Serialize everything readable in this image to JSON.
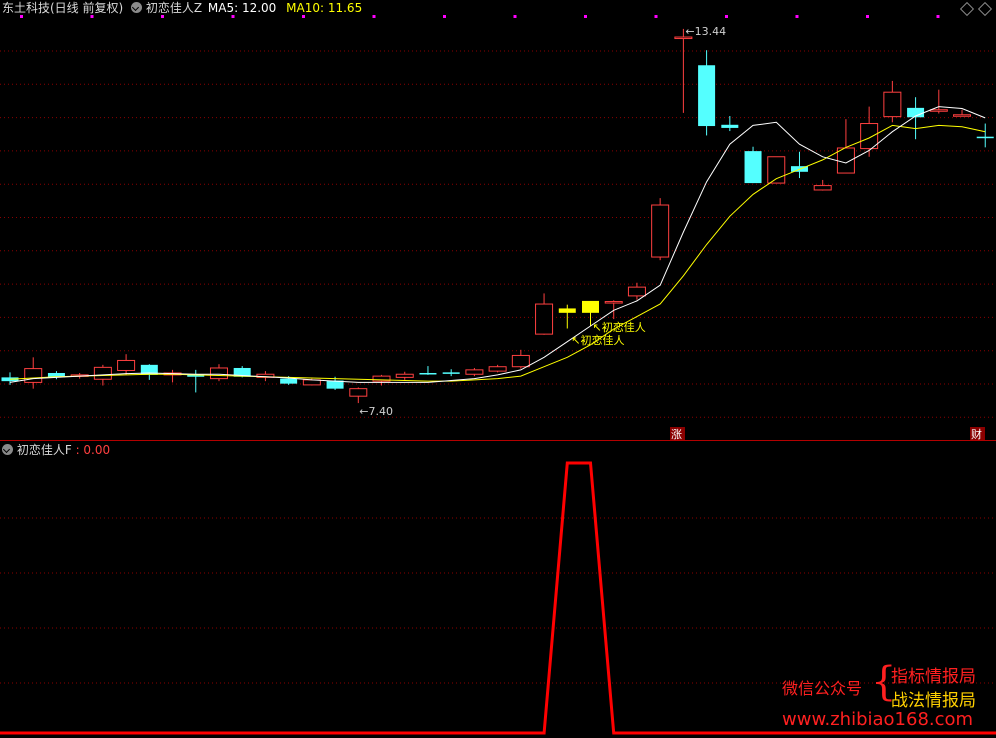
{
  "header": {
    "stock_title": "东土科技(日线 前复权)",
    "indicator_name": "初恋佳人Z",
    "ma5_label": "MA5: 12.00",
    "ma10_label": "MA10: 11.65"
  },
  "sub_header": {
    "indicator_name": "初恋佳人F",
    "value": ": 0.00"
  },
  "annotations": {
    "high_price": "13.44",
    "low_price": "7.40",
    "signal_label_1": "初恋佳人",
    "signal_label_2": "初恋佳人",
    "zhang_badge": "涨",
    "cai_badge": "财"
  },
  "watermark": {
    "wechat_label": "微信公众号",
    "line1": "指标情报局",
    "line2": "战法情报局",
    "url": "www.zhibiao168.com"
  },
  "colors": {
    "up": "#ff4040",
    "down": "#54ffff",
    "signal": "#ffff00",
    "ma5": "#ffffff",
    "ma10": "#ffff00",
    "grid": "#8b0000",
    "indicator_line": "#ff0000"
  },
  "chart_data": {
    "type": "candlestick",
    "ylim": [
      7.2,
      13.55
    ],
    "candles": [
      {
        "o": 7.82,
        "h": 7.96,
        "l": 7.76,
        "c": 7.88,
        "t": "down"
      },
      {
        "o": 7.8,
        "h": 8.2,
        "l": 7.7,
        "c": 8.02,
        "t": "up"
      },
      {
        "o": 7.95,
        "h": 7.98,
        "l": 7.85,
        "c": 7.88,
        "t": "down"
      },
      {
        "o": 7.9,
        "h": 7.95,
        "l": 7.86,
        "c": 7.92,
        "t": "up"
      },
      {
        "o": 7.85,
        "h": 8.08,
        "l": 7.75,
        "c": 8.04,
        "t": "up"
      },
      {
        "o": 7.99,
        "h": 8.25,
        "l": 7.92,
        "c": 8.15,
        "t": "up"
      },
      {
        "o": 8.08,
        "h": 8.09,
        "l": 7.84,
        "c": 7.92,
        "t": "down"
      },
      {
        "o": 7.95,
        "h": 8.0,
        "l": 7.8,
        "c": 7.92,
        "t": "up"
      },
      {
        "o": 7.92,
        "h": 8.0,
        "l": 7.64,
        "c": 7.89,
        "t": "down"
      },
      {
        "o": 7.86,
        "h": 8.09,
        "l": 7.82,
        "c": 8.03,
        "t": "up"
      },
      {
        "o": 8.03,
        "h": 8.06,
        "l": 7.88,
        "c": 7.89,
        "t": "down"
      },
      {
        "o": 7.88,
        "h": 7.98,
        "l": 7.82,
        "c": 7.93,
        "t": "up"
      },
      {
        "o": 7.86,
        "h": 7.9,
        "l": 7.76,
        "c": 7.78,
        "t": "down"
      },
      {
        "o": 7.76,
        "h": 7.86,
        "l": 7.75,
        "c": 7.84,
        "t": "up"
      },
      {
        "o": 7.83,
        "h": 7.89,
        "l": 7.68,
        "c": 7.7,
        "t": "down"
      },
      {
        "o": 7.58,
        "h": 7.72,
        "l": 7.47,
        "c": 7.7,
        "t": "up"
      },
      {
        "o": 7.82,
        "h": 7.92,
        "l": 7.75,
        "c": 7.9,
        "t": "up"
      },
      {
        "o": 7.88,
        "h": 7.97,
        "l": 7.84,
        "c": 7.93,
        "t": "up"
      },
      {
        "o": 7.95,
        "h": 8.06,
        "l": 7.92,
        "c": 7.93,
        "t": "down"
      },
      {
        "o": 7.96,
        "h": 8.01,
        "l": 7.9,
        "c": 7.94,
        "t": "down"
      },
      {
        "o": 7.93,
        "h": 8.03,
        "l": 7.9,
        "c": 8.0,
        "t": "up"
      },
      {
        "o": 7.98,
        "h": 8.08,
        "l": 7.96,
        "c": 8.05,
        "t": "up"
      },
      {
        "o": 8.05,
        "h": 8.32,
        "l": 8.02,
        "c": 8.23,
        "t": "up"
      },
      {
        "o": 8.57,
        "h": 9.22,
        "l": 8.56,
        "c": 9.05,
        "t": "up"
      },
      {
        "o": 8.91,
        "h": 9.04,
        "l": 8.66,
        "c": 8.98,
        "t": "signal"
      },
      {
        "o": 8.91,
        "h": 9.09,
        "l": 8.7,
        "c": 9.1,
        "t": "signal"
      },
      {
        "o": 9.08,
        "h": 9.11,
        "l": 8.81,
        "c": 9.09,
        "t": "up"
      },
      {
        "o": 9.18,
        "h": 9.39,
        "l": 9.12,
        "c": 9.32,
        "t": "up"
      },
      {
        "o": 9.8,
        "h": 10.74,
        "l": 9.75,
        "c": 10.63,
        "t": "up"
      },
      {
        "o": 13.3,
        "h": 13.44,
        "l": 12.1,
        "c": 13.31,
        "t": "up"
      },
      {
        "o": 12.86,
        "h": 13.1,
        "l": 11.74,
        "c": 11.89,
        "t": "down"
      },
      {
        "o": 11.91,
        "h": 12.05,
        "l": 11.81,
        "c": 11.86,
        "t": "down"
      },
      {
        "o": 11.49,
        "h": 11.56,
        "l": 10.98,
        "c": 10.98,
        "t": "down"
      },
      {
        "o": 10.98,
        "h": 11.4,
        "l": 10.98,
        "c": 11.4,
        "t": "up"
      },
      {
        "o": 11.25,
        "h": 11.48,
        "l": 11.06,
        "c": 11.16,
        "t": "down"
      },
      {
        "o": 10.87,
        "h": 11.03,
        "l": 10.86,
        "c": 10.94,
        "t": "up"
      },
      {
        "o": 11.14,
        "h": 12.0,
        "l": 11.14,
        "c": 11.54,
        "t": "up"
      },
      {
        "o": 11.53,
        "h": 12.2,
        "l": 11.4,
        "c": 11.93,
        "t": "up"
      },
      {
        "o": 12.04,
        "h": 12.61,
        "l": 11.95,
        "c": 12.43,
        "t": "up"
      },
      {
        "o": 12.18,
        "h": 12.35,
        "l": 11.68,
        "c": 12.03,
        "t": "down"
      },
      {
        "o": 12.15,
        "h": 12.47,
        "l": 12.09,
        "c": 12.14,
        "t": "up"
      },
      {
        "o": 12.07,
        "h": 12.15,
        "l": 12.05,
        "c": 12.07,
        "t": "up"
      },
      {
        "o": 11.72,
        "h": 11.93,
        "l": 11.55,
        "c": 11.72,
        "t": "down"
      }
    ],
    "ma5": [
      7.8,
      7.86,
      7.88,
      7.9,
      7.92,
      7.94,
      7.95,
      7.94,
      7.93,
      7.93,
      7.91,
      7.89,
      7.87,
      7.84,
      7.82,
      7.8,
      7.8,
      7.8,
      7.8,
      7.83,
      7.86,
      7.92,
      8.0,
      8.2,
      8.45,
      8.7,
      8.95,
      9.1,
      9.35,
      10.2,
      11.0,
      11.6,
      11.9,
      11.95,
      11.6,
      11.4,
      11.3,
      11.5,
      11.8,
      12.05,
      12.2,
      12.17,
      12.02
    ],
    "ma10": [
      7.85,
      7.87,
      7.89,
      7.9,
      7.91,
      7.92,
      7.93,
      7.93,
      7.92,
      7.91,
      7.9,
      7.89,
      7.88,
      7.87,
      7.86,
      7.85,
      7.84,
      7.83,
      7.82,
      7.82,
      7.84,
      7.86,
      7.9,
      8.05,
      8.2,
      8.4,
      8.65,
      8.85,
      9.05,
      9.5,
      10.0,
      10.45,
      10.8,
      11.05,
      11.2,
      11.35,
      11.55,
      11.7,
      11.9,
      11.85,
      11.9,
      11.88,
      11.8
    ],
    "indicator_F": {
      "name": "初恋佳人F",
      "values": [
        0,
        0,
        0,
        0,
        0,
        0,
        0,
        0,
        0,
        0,
        0,
        0,
        0,
        0,
        0,
        0,
        0,
        0,
        0,
        0,
        0,
        0,
        0,
        0,
        1,
        1,
        0,
        0,
        0,
        0,
        0,
        0,
        0,
        0,
        0,
        0,
        0,
        0,
        0,
        0,
        0,
        0,
        0
      ],
      "ylim": [
        0,
        1
      ]
    }
  }
}
